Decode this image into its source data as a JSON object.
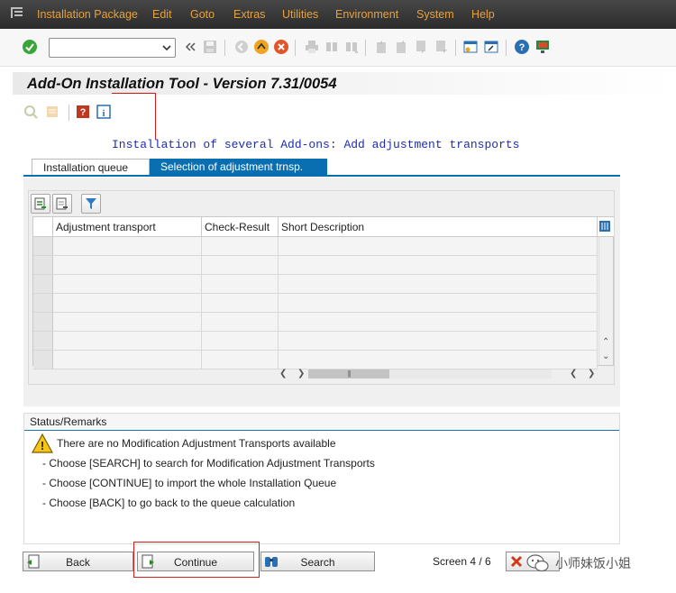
{
  "menu": {
    "items": [
      "Installation Package",
      "Edit",
      "Goto",
      "Extras",
      "Utilities",
      "Environment",
      "System",
      "Help"
    ]
  },
  "toolbar": {
    "command_value": "",
    "icons": [
      "enter-icon",
      "command-dropdown-icon",
      "collapse-icon",
      "save-icon",
      "back-icon",
      "exit-icon",
      "cancel-icon",
      "print-icon",
      "find-icon",
      "find-next-icon",
      "first-page-icon",
      "previous-page-icon",
      "next-page-icon",
      "last-page-icon",
      "new-session-icon",
      "shortcut-icon",
      "help-icon",
      "customize-layout-icon"
    ]
  },
  "title": "Add-On Installation Tool - Version 7.31/0054",
  "app_toolbar": {
    "icons": [
      "display-icon",
      "log-icon",
      "help-book-icon",
      "info-icon"
    ]
  },
  "subtitle": "Installation of several Add-ons: Add adjustment transports",
  "tabs": [
    {
      "label": "Installation queue",
      "active": false
    },
    {
      "label": "Selection of adjustment trnsp.",
      "active": true
    }
  ],
  "table": {
    "toolbar_icons": [
      "select-all-icon",
      "deselect-all-icon",
      "filter-icon"
    ],
    "columns": [
      "Adjustment transport",
      "Check-Result",
      "Short Description"
    ],
    "rows": [
      [
        "",
        "",
        ""
      ],
      [
        "",
        "",
        ""
      ],
      [
        "",
        "",
        ""
      ],
      [
        "",
        "",
        ""
      ],
      [
        "",
        "",
        ""
      ],
      [
        "",
        "",
        ""
      ],
      [
        "",
        "",
        ""
      ]
    ]
  },
  "status": {
    "header": "Status/Remarks",
    "warning": "There are no Modification Adjustment Transports available",
    "lines": [
      "- Choose [SEARCH] to search for Modification Adjustment Transports",
      "- Choose [CONTINUE] to import the whole Installation Queue",
      "- Choose [BACK] to go back to the queue calculation"
    ]
  },
  "buttons": {
    "back": "Back",
    "continue": "Continue",
    "search": "Search"
  },
  "screen_info": "Screen 4 / 6",
  "watermark": "小师妹饭小姐",
  "colors": {
    "menu_text": "#e8a23c",
    "tab_active": "#0a6fb0",
    "subtitle": "#1f2db0",
    "annotation": "#cc1d1d"
  }
}
